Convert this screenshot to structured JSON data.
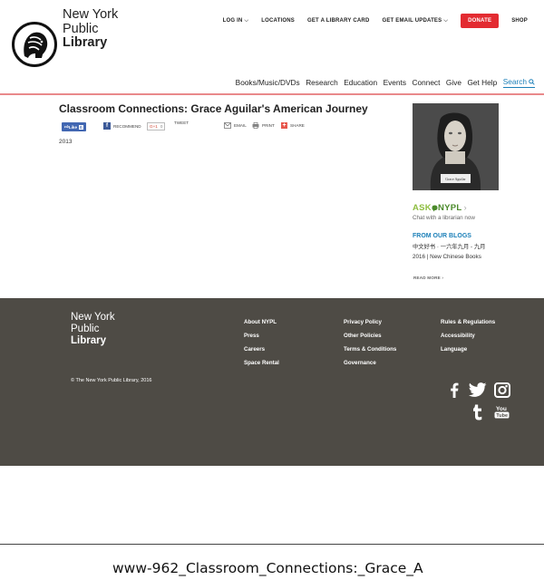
{
  "header": {
    "logo_lines": [
      "New York",
      "Public",
      "Library"
    ],
    "top_nav": [
      {
        "label": "LOG IN",
        "chevron": true
      },
      {
        "label": "LOCATIONS",
        "chevron": false
      },
      {
        "label": "GET A LIBRARY CARD",
        "chevron": false
      },
      {
        "label": "GET EMAIL UPDATES",
        "chevron": true
      }
    ],
    "donate_label": "DONATE",
    "shop_label": "SHOP",
    "main_nav": [
      "Books/Music/DVDs",
      "Research",
      "Education",
      "Events",
      "Connect",
      "Give",
      "Get Help"
    ],
    "search_label": "Search",
    "colors": {
      "donate": "#e32b31",
      "accent": "#1b7fb8",
      "divider": "#e9898b"
    }
  },
  "article": {
    "title": "Classroom Connections: Grace Aguilar's American Journey",
    "share": {
      "like_label": "Like",
      "like_count": "0",
      "recommend_label": "RECOMMEND",
      "gplus_label": "G+1",
      "gplus_count": "0",
      "tweet_label": "TWEET",
      "email_label": "EMAIL",
      "print_label": "PRINT",
      "share_label": "SHARE"
    },
    "year": "2013"
  },
  "sidebar": {
    "portrait_caption": "Grace Aguilar",
    "ask_prefix": "ASK",
    "ask_brand": "NYPL",
    "ask_sub": "Chat with a librarian now",
    "blogs_heading": "FROM OUR BLOGS",
    "blog_item": "中文好书 · 一六年九月 - 九月 2016 | New Chinese Books",
    "read_more": "READ MORE ›"
  },
  "footer": {
    "logo_lines": [
      "New York",
      "Public",
      "Library"
    ],
    "col1": [
      "About NYPL",
      "Press",
      "Careers",
      "Space Rental"
    ],
    "col2": [
      "Privacy Policy",
      "Other Policies",
      "Terms & Conditions",
      "Governance"
    ],
    "col3": [
      "Rules & Regulations",
      "Accessibility",
      "Language"
    ],
    "copyright": "© The New York Public Library, 2016",
    "social": [
      "facebook-icon",
      "twitter-icon",
      "instagram-icon",
      "tumblr-icon",
      "youtube-icon"
    ],
    "bg_color": "#4e4b45"
  },
  "caption": "www-962_Classroom_Connections:_Grace_A"
}
